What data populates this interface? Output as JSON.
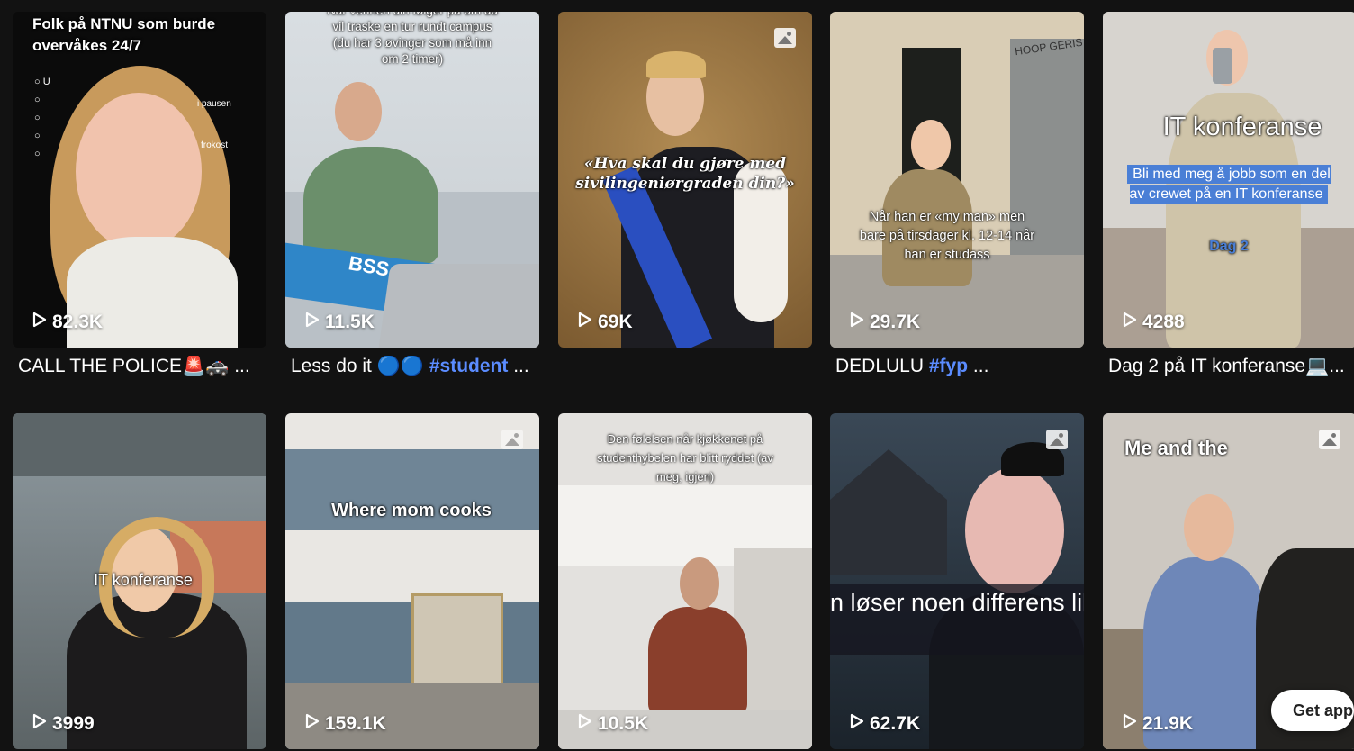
{
  "videos": [
    {
      "views": "82.3K",
      "caption": "CALL THE POLICE",
      "caption_emoji": "🚨🚓",
      "caption_more": " ...",
      "overlay": "Folk på NTNU som burde overvåkes 24/7",
      "list_1": "i pausen",
      "list_2": "frokost",
      "list_3": "U"
    },
    {
      "views": "11.5K",
      "caption": "Less do it",
      "caption_emoji": " 🔵🔵 ",
      "caption_tag": "#student",
      "caption_more": " ...",
      "overlay": "Når vennen din følger på om du vil traske en tur rundt campus (du har 3 øvinger som må inn om 2 timer)",
      "laptop": "BSS"
    },
    {
      "views": "69K",
      "caption": "",
      "overlay": "«Hva skal du gjøre med sivilingeniørgraden din?»"
    },
    {
      "views": "29.7K",
      "caption": "DEDLULU",
      "caption_tag": "#fyp",
      "caption_more": " ...",
      "overlay": "Når han er «my man» men bare på tirsdager kl. 12-14 når han er studass",
      "graffiti": "HOOP GERIS"
    },
    {
      "views": "4288",
      "caption": "Dag 2 på IT konferanse",
      "caption_emoji": "💻",
      "caption_more": "...",
      "overlay_title": "IT konferanse",
      "overlay_box": "Bli med meg å jobb som en del av crewet på en IT konferanse",
      "overlay_day": "Dag 2"
    },
    {
      "views": "3999",
      "caption": "",
      "overlay": "IT konferanse"
    },
    {
      "views": "159.1K",
      "caption": "",
      "overlay": "Where mom cooks"
    },
    {
      "views": "10.5K",
      "caption": "",
      "overlay": "Den følelsen når kjøkkenet på studenthybelen har blitt ryddet (av meg, igjen)"
    },
    {
      "views": "62.7K",
      "caption": "",
      "overlay": "n løser noen differens likninger i ny og ne?"
    },
    {
      "views": "21.9K",
      "caption": "",
      "overlay": "Me and the"
    }
  ],
  "get_app": "Get app",
  "colors": {
    "background": "#121212",
    "hashtag": "#5b8cff"
  }
}
